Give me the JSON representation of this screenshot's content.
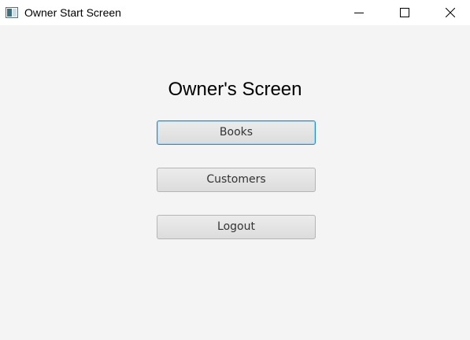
{
  "window": {
    "title": "Owner Start Screen",
    "icon": "java-app-icon",
    "controls": {
      "minimize_icon": "minimize-icon",
      "maximize_icon": "maximize-icon",
      "close_icon": "close-icon"
    }
  },
  "screen": {
    "heading": "Owner's Screen",
    "buttons": {
      "books": "Books",
      "customers": "Customers",
      "logout": "Logout"
    },
    "focused_button": "books"
  },
  "colors": {
    "background": "#f4f4f4",
    "focus_border": "#1a8fd6",
    "button_border": "#b5b5b5"
  }
}
